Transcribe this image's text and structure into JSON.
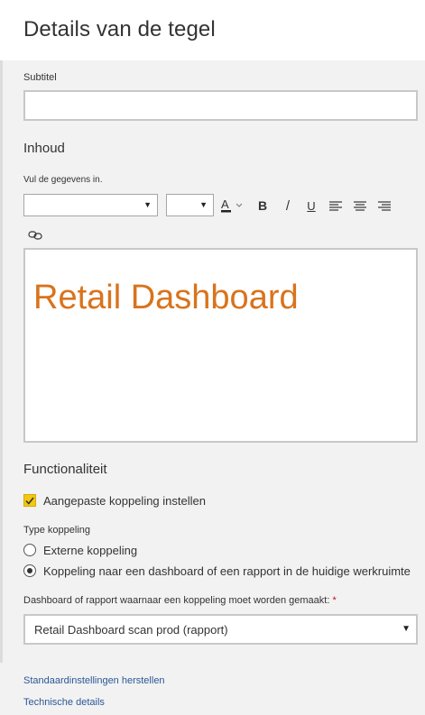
{
  "header": {
    "title": "Details van de tegel"
  },
  "subtitle": {
    "label": "Subtitel",
    "value": ""
  },
  "content": {
    "section_title": "Inhoud",
    "instruction": "Vul de gegevens in.",
    "font_family_value": "",
    "font_size_value": "",
    "toolbar": {
      "font_color_icon": "A",
      "bold_icon": "B",
      "italic_icon": "/",
      "underline_icon": "U"
    },
    "editor_text": "Retail Dashboard",
    "editor_text_color": "#d9731c"
  },
  "functionality": {
    "section_title": "Functionaliteit",
    "custom_link_label": "Aangepaste koppeling instellen",
    "custom_link_checked": true,
    "link_type_label": "Type koppeling",
    "link_type_options": [
      {
        "label": "Externe koppeling",
        "selected": false
      },
      {
        "label": "Koppeling naar een dashboard of een rapport in de huidige werkruimte",
        "selected": true
      }
    ],
    "target_label": "Dashboard of rapport waarnaar een koppeling moet worden gemaakt:",
    "target_required_marker": "*",
    "target_value": "Retail Dashboard scan prod (rapport)"
  },
  "footer": {
    "reset_link": "Standaardinstellingen herstellen",
    "tech_link": "Technische details"
  },
  "colors": {
    "accent_checkbox": "#f2c811",
    "link": "#2b5797",
    "required": "#c50f1f"
  }
}
